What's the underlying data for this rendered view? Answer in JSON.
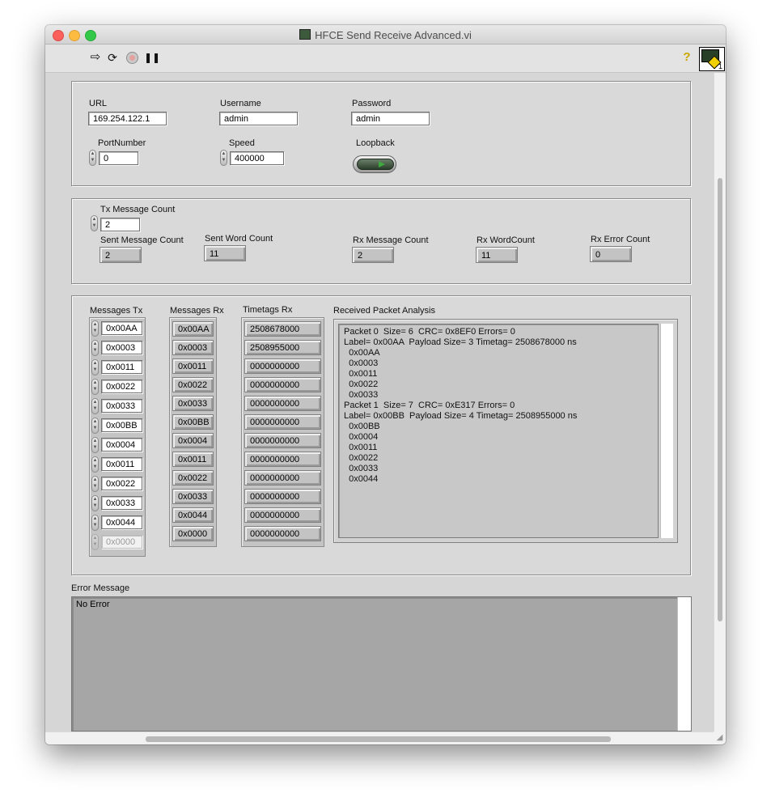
{
  "window": {
    "title": "HFCE Send Receive Advanced.vi"
  },
  "toolbar": {
    "run_icon": "run-arrow-icon",
    "run_continuous_icon": "run-continuously-icon",
    "abort_icon": "abort-icon",
    "pause_icon": "pause-icon",
    "help_icon": "context-help-icon",
    "vi_icon_number": "1"
  },
  "connection": {
    "url_label": "URL",
    "url_value": "169.254.122.1",
    "username_label": "Username",
    "username_value": "admin",
    "password_label": "Password",
    "password_value": "admin",
    "port_label": "PortNumber",
    "port_value": "0",
    "speed_label": "Speed",
    "speed_value": "400000",
    "loopback_label": "Loopback"
  },
  "counts": {
    "tx_message_count_label": "Tx Message Count",
    "tx_message_count_value": "2",
    "sent_message_count_label": "Sent Message Count",
    "sent_message_count_value": "2",
    "sent_word_count_label": "Sent Word Count",
    "sent_word_count_value": "11",
    "rx_message_count_label": "Rx Message Count",
    "rx_message_count_value": "2",
    "rx_word_count_label": "Rx WordCount",
    "rx_word_count_value": "11",
    "rx_error_count_label": "Rx Error Count",
    "rx_error_count_value": "0"
  },
  "arrays": {
    "messages_tx_label": "Messages Tx",
    "messages_tx": [
      "0x00AA",
      "0x0003",
      "0x0011",
      "0x0022",
      "0x0033",
      "0x00BB",
      "0x0004",
      "0x0011",
      "0x0022",
      "0x0033",
      "0x0044",
      "0x0000"
    ],
    "messages_rx_label": "Messages Rx",
    "messages_rx": [
      "0x00AA",
      "0x0003",
      "0x0011",
      "0x0022",
      "0x0033",
      "0x00BB",
      "0x0004",
      "0x0011",
      "0x0022",
      "0x0033",
      "0x0044",
      "0x0000"
    ],
    "timetags_rx_label": "Timetags Rx",
    "timetags_rx": [
      "2508678000",
      "2508955000",
      "0000000000",
      "0000000000",
      "0000000000",
      "0000000000",
      "0000000000",
      "0000000000",
      "0000000000",
      "0000000000",
      "0000000000",
      "0000000000"
    ]
  },
  "analysis": {
    "label": "Received Packet Analysis",
    "text": "Packet 0  Size= 6  CRC= 0x8EF0 Errors= 0\nLabel= 0x00AA  Payload Size= 3 Timetag= 2508678000 ns\n  0x00AA\n  0x0003\n  0x0011\n  0x0022\n  0x0033\nPacket 1  Size= 7  CRC= 0xE317 Errors= 0\nLabel= 0x00BB  Payload Size= 4 Timetag= 2508955000 ns\n  0x00BB\n  0x0004\n  0x0011\n  0x0022\n  0x0033\n  0x0044"
  },
  "error": {
    "label": "Error Message",
    "text": "No Error"
  }
}
